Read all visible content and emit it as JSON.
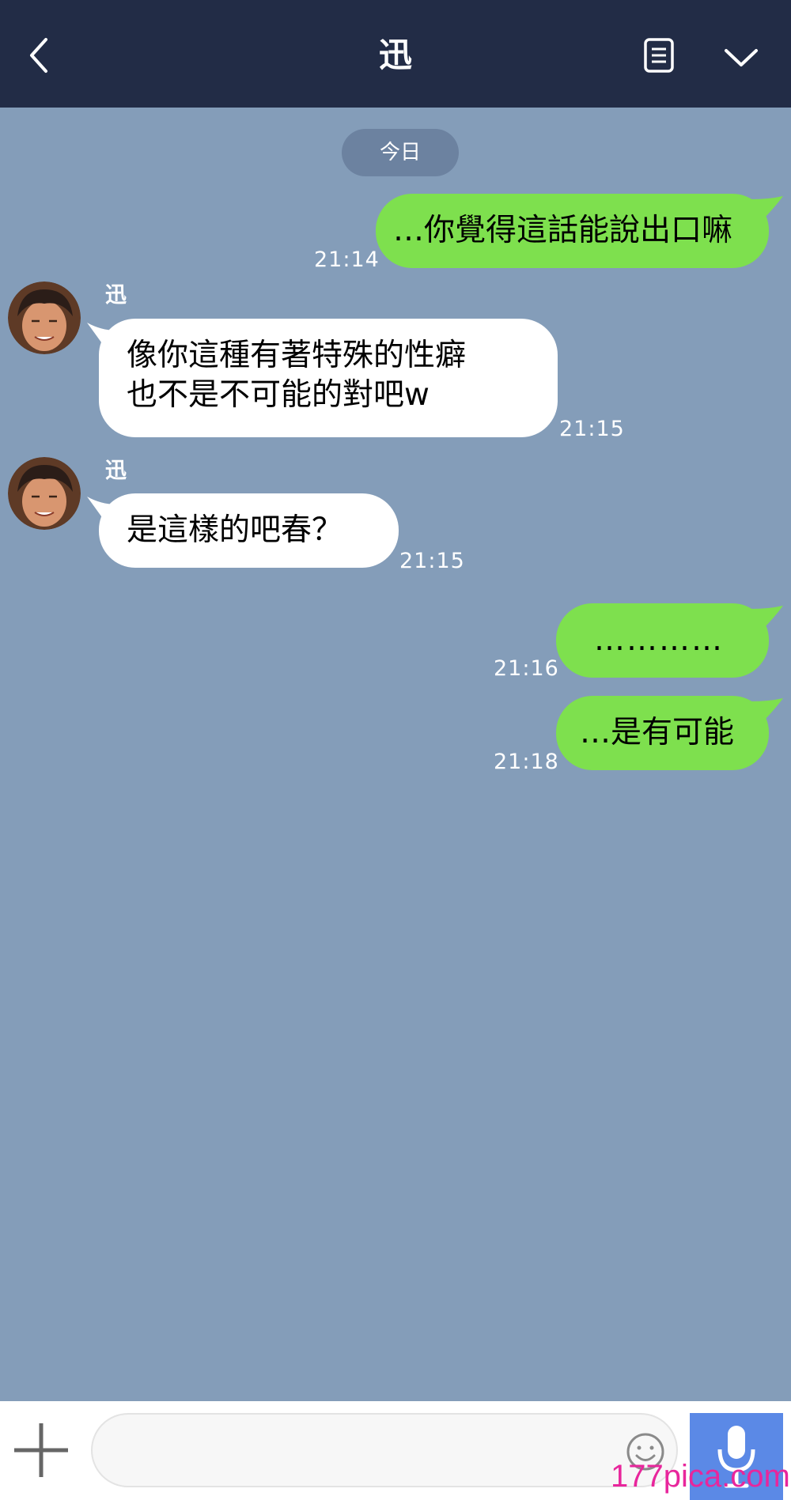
{
  "header": {
    "title": "迅"
  },
  "date_label": "今日",
  "messages": [
    {
      "direction": "outgoing",
      "text": "…你覺得這話能說出口嘛",
      "time": "21:14"
    },
    {
      "direction": "incoming",
      "sender": "迅",
      "lines": [
        "像你這種有著特殊的性癖",
        "也不是不可能的對吧w"
      ],
      "time": "21:15"
    },
    {
      "direction": "incoming",
      "sender": "迅",
      "text": "是這樣的吧春？",
      "time": "21:15"
    },
    {
      "direction": "outgoing",
      "text": "…………",
      "time": "21:16"
    },
    {
      "direction": "outgoing",
      "text": "…是有可能",
      "time": "21:18"
    }
  ],
  "footer": {
    "input_value": ""
  },
  "icons": {
    "back": "chevron-left-icon",
    "notes": "notes-icon",
    "menu": "chevron-down-icon",
    "add": "plus-icon",
    "emoji": "emoji-icon",
    "mic": "microphone-icon"
  },
  "colors": {
    "header_bg": "#222c46",
    "chat_bg": "#849db9",
    "outgoing_bubble": "#7ee04e",
    "incoming_bubble": "#ffffff",
    "mic_button": "#5b89e6"
  },
  "watermark": "177pica.com"
}
